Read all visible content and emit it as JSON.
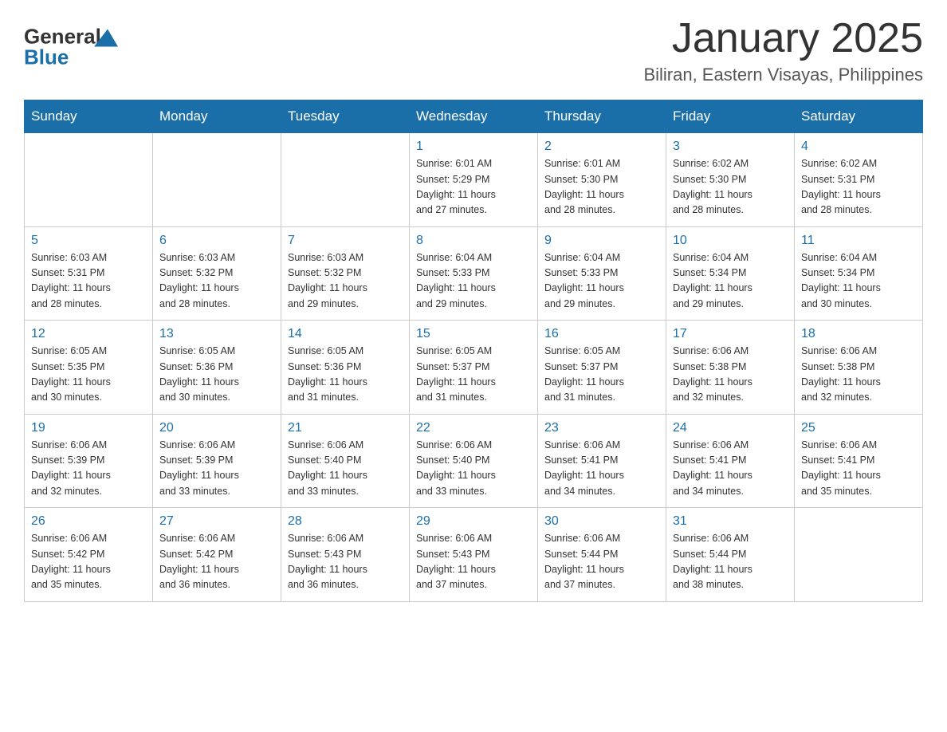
{
  "header": {
    "logo_general": "General",
    "logo_blue": "Blue",
    "month_title": "January 2025",
    "subtitle": "Biliran, Eastern Visayas, Philippines"
  },
  "days_of_week": [
    "Sunday",
    "Monday",
    "Tuesday",
    "Wednesday",
    "Thursday",
    "Friday",
    "Saturday"
  ],
  "weeks": [
    [
      {
        "day": "",
        "info": ""
      },
      {
        "day": "",
        "info": ""
      },
      {
        "day": "",
        "info": ""
      },
      {
        "day": "1",
        "info": "Sunrise: 6:01 AM\nSunset: 5:29 PM\nDaylight: 11 hours\nand 27 minutes."
      },
      {
        "day": "2",
        "info": "Sunrise: 6:01 AM\nSunset: 5:30 PM\nDaylight: 11 hours\nand 28 minutes."
      },
      {
        "day": "3",
        "info": "Sunrise: 6:02 AM\nSunset: 5:30 PM\nDaylight: 11 hours\nand 28 minutes."
      },
      {
        "day": "4",
        "info": "Sunrise: 6:02 AM\nSunset: 5:31 PM\nDaylight: 11 hours\nand 28 minutes."
      }
    ],
    [
      {
        "day": "5",
        "info": "Sunrise: 6:03 AM\nSunset: 5:31 PM\nDaylight: 11 hours\nand 28 minutes."
      },
      {
        "day": "6",
        "info": "Sunrise: 6:03 AM\nSunset: 5:32 PM\nDaylight: 11 hours\nand 28 minutes."
      },
      {
        "day": "7",
        "info": "Sunrise: 6:03 AM\nSunset: 5:32 PM\nDaylight: 11 hours\nand 29 minutes."
      },
      {
        "day": "8",
        "info": "Sunrise: 6:04 AM\nSunset: 5:33 PM\nDaylight: 11 hours\nand 29 minutes."
      },
      {
        "day": "9",
        "info": "Sunrise: 6:04 AM\nSunset: 5:33 PM\nDaylight: 11 hours\nand 29 minutes."
      },
      {
        "day": "10",
        "info": "Sunrise: 6:04 AM\nSunset: 5:34 PM\nDaylight: 11 hours\nand 29 minutes."
      },
      {
        "day": "11",
        "info": "Sunrise: 6:04 AM\nSunset: 5:34 PM\nDaylight: 11 hours\nand 30 minutes."
      }
    ],
    [
      {
        "day": "12",
        "info": "Sunrise: 6:05 AM\nSunset: 5:35 PM\nDaylight: 11 hours\nand 30 minutes."
      },
      {
        "day": "13",
        "info": "Sunrise: 6:05 AM\nSunset: 5:36 PM\nDaylight: 11 hours\nand 30 minutes."
      },
      {
        "day": "14",
        "info": "Sunrise: 6:05 AM\nSunset: 5:36 PM\nDaylight: 11 hours\nand 31 minutes."
      },
      {
        "day": "15",
        "info": "Sunrise: 6:05 AM\nSunset: 5:37 PM\nDaylight: 11 hours\nand 31 minutes."
      },
      {
        "day": "16",
        "info": "Sunrise: 6:05 AM\nSunset: 5:37 PM\nDaylight: 11 hours\nand 31 minutes."
      },
      {
        "day": "17",
        "info": "Sunrise: 6:06 AM\nSunset: 5:38 PM\nDaylight: 11 hours\nand 32 minutes."
      },
      {
        "day": "18",
        "info": "Sunrise: 6:06 AM\nSunset: 5:38 PM\nDaylight: 11 hours\nand 32 minutes."
      }
    ],
    [
      {
        "day": "19",
        "info": "Sunrise: 6:06 AM\nSunset: 5:39 PM\nDaylight: 11 hours\nand 32 minutes."
      },
      {
        "day": "20",
        "info": "Sunrise: 6:06 AM\nSunset: 5:39 PM\nDaylight: 11 hours\nand 33 minutes."
      },
      {
        "day": "21",
        "info": "Sunrise: 6:06 AM\nSunset: 5:40 PM\nDaylight: 11 hours\nand 33 minutes."
      },
      {
        "day": "22",
        "info": "Sunrise: 6:06 AM\nSunset: 5:40 PM\nDaylight: 11 hours\nand 33 minutes."
      },
      {
        "day": "23",
        "info": "Sunrise: 6:06 AM\nSunset: 5:41 PM\nDaylight: 11 hours\nand 34 minutes."
      },
      {
        "day": "24",
        "info": "Sunrise: 6:06 AM\nSunset: 5:41 PM\nDaylight: 11 hours\nand 34 minutes."
      },
      {
        "day": "25",
        "info": "Sunrise: 6:06 AM\nSunset: 5:41 PM\nDaylight: 11 hours\nand 35 minutes."
      }
    ],
    [
      {
        "day": "26",
        "info": "Sunrise: 6:06 AM\nSunset: 5:42 PM\nDaylight: 11 hours\nand 35 minutes."
      },
      {
        "day": "27",
        "info": "Sunrise: 6:06 AM\nSunset: 5:42 PM\nDaylight: 11 hours\nand 36 minutes."
      },
      {
        "day": "28",
        "info": "Sunrise: 6:06 AM\nSunset: 5:43 PM\nDaylight: 11 hours\nand 36 minutes."
      },
      {
        "day": "29",
        "info": "Sunrise: 6:06 AM\nSunset: 5:43 PM\nDaylight: 11 hours\nand 37 minutes."
      },
      {
        "day": "30",
        "info": "Sunrise: 6:06 AM\nSunset: 5:44 PM\nDaylight: 11 hours\nand 37 minutes."
      },
      {
        "day": "31",
        "info": "Sunrise: 6:06 AM\nSunset: 5:44 PM\nDaylight: 11 hours\nand 38 minutes."
      },
      {
        "day": "",
        "info": ""
      }
    ]
  ]
}
